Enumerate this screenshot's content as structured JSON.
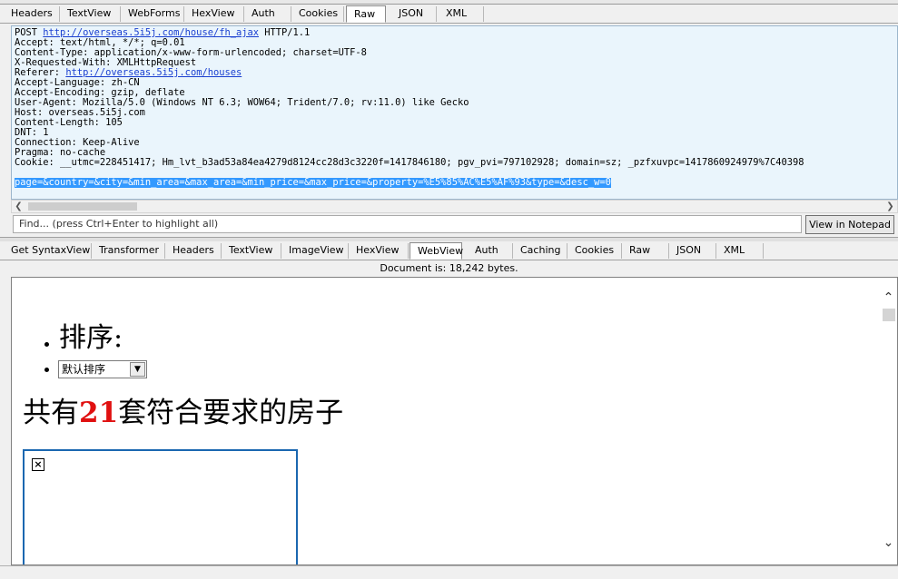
{
  "request_tabs": [
    {
      "label": "Headers"
    },
    {
      "label": "TextView"
    },
    {
      "label": "WebForms"
    },
    {
      "label": "HexView"
    },
    {
      "label": "Auth"
    },
    {
      "label": "Cookies"
    },
    {
      "label": "Raw"
    },
    {
      "label": "JSON"
    },
    {
      "label": "XML"
    }
  ],
  "request_active_tab": "Raw",
  "raw": {
    "request_line_method": "POST ",
    "request_url": "http://overseas.5i5j.com/house/fh_ajax",
    "request_line_version": " HTTP/1.1",
    "headers_1": "Accept: text/html, */*; q=0.01\nContent-Type: application/x-www-form-urlencoded; charset=UTF-8\nX-Requested-With: XMLHttpRequest",
    "referer_label": "Referer: ",
    "referer_url": "http://overseas.5i5j.com/houses",
    "headers_2": "Accept-Language: zh-CN\nAccept-Encoding: gzip, deflate\nUser-Agent: Mozilla/5.0 (Windows NT 6.3; WOW64; Trident/7.0; rv:11.0) like Gecko\nHost: overseas.5i5j.com\nContent-Length: 105\nDNT: 1\nConnection: Keep-Alive\nPragma: no-cache\nCookie: __utmc=228451417; Hm_lvt_b3ad53a84ea4279d8124cc28d3c3220f=1417846180; pgv_pvi=797102928; domain=sz; _pzfxuvpc=1417860924979%7C40398",
    "body": "page=&country=&city=&min_area=&max_area=&min_price=&max_price=&property=%E5%85%AC%E5%AF%93&type=&desc_w=0"
  },
  "find": {
    "placeholder": "Find... (press Ctrl+Enter to highlight all)",
    "notepad_button": "View in Notepad"
  },
  "response_tabs": [
    {
      "label": "Get SyntaxView"
    },
    {
      "label": "Transformer"
    },
    {
      "label": "Headers"
    },
    {
      "label": "TextView"
    },
    {
      "label": "ImageView"
    },
    {
      "label": "HexView"
    },
    {
      "label": "WebView"
    },
    {
      "label": "Auth"
    },
    {
      "label": "Caching"
    },
    {
      "label": "Cookies"
    },
    {
      "label": "Raw"
    },
    {
      "label": "JSON"
    },
    {
      "label": "XML"
    }
  ],
  "response_active_tab": "WebView",
  "doc_size": "Document is: 18,242 bytes.",
  "webview": {
    "sort_heading": "排序:",
    "sort_select_value": "默认排序",
    "result_prefix": "共有",
    "result_count": "21",
    "result_suffix": "套符合要求的房子"
  },
  "colors": {
    "raw_bg": "#eaf5fc",
    "selection": "#3399ff",
    "link": "#1a3fd0",
    "count_red": "#e01010",
    "listing_border": "#1b67b0"
  }
}
